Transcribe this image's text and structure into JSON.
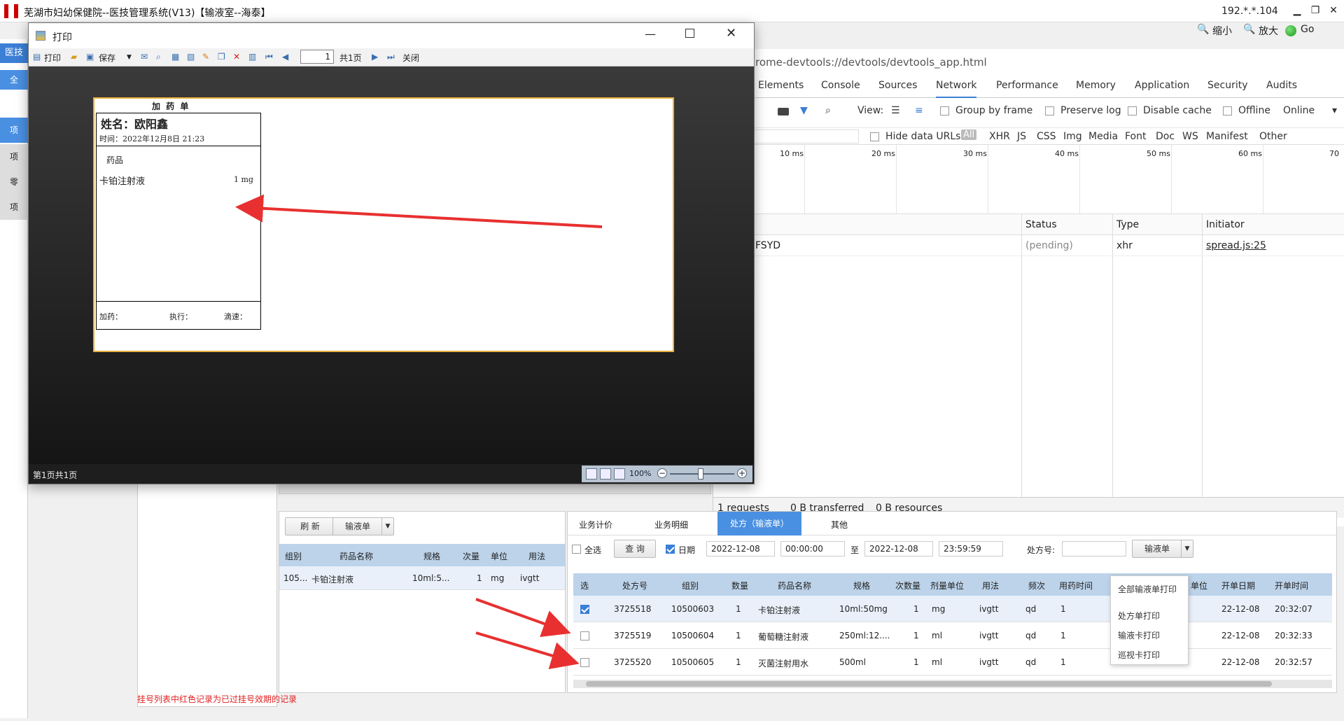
{
  "app": {
    "title": "芜湖市妇幼保健院--医技管理系统(V13)【输液室--海泰】",
    "ip": "192.*.*.104",
    "zoom_out": "缩小",
    "zoom_in": "放大",
    "go": "Go"
  },
  "sidebar": {
    "items": [
      "医技",
      "全",
      "项",
      "项",
      "零",
      "项"
    ]
  },
  "devtools": {
    "url": "rome-devtools://devtools/devtools_app.html",
    "tabs": [
      "Elements",
      "Console",
      "Sources",
      "Network",
      "Performance",
      "Memory",
      "Application",
      "Security",
      "Audits"
    ],
    "active_tab": "Network",
    "toolbar": {
      "view": "View:",
      "group_by_frame": "Group by frame",
      "preserve_log": "Preserve log",
      "disable_cache": "Disable cache",
      "offline": "Offline",
      "online": "Online"
    },
    "filters": {
      "hide_data_urls": "Hide data URLs",
      "types": [
        "All",
        "XHR",
        "JS",
        "CSS",
        "Img",
        "Media",
        "Font",
        "Doc",
        "WS",
        "Manifest",
        "Other"
      ]
    },
    "timeline": [
      "10 ms",
      "20 ms",
      "30 ms",
      "40 ms",
      "50 ms",
      "60 ms",
      "70"
    ],
    "columns": [
      "Status",
      "Type",
      "Initiator"
    ],
    "request": {
      "name": "FSYD",
      "status": "(pending)",
      "type": "xhr",
      "initiator": "spread.js:25"
    },
    "summary": {
      "requests": "1 requests",
      "transferred": "0 B transferred",
      "resources": "0 B resources"
    }
  },
  "print": {
    "title": "打印",
    "toolbar": {
      "print": "打印",
      "save": "保存",
      "page": "1",
      "total": "共1页",
      "close": "关闭"
    },
    "status": "第1页共1页",
    "zoom": "100%",
    "slip": {
      "title": "加 药 单",
      "name": "姓名：欧阳鑫",
      "time": "时间：2022年12月8日 21:23",
      "drug_header": "药品",
      "drug": "卡铂注射液",
      "dose": "1 mg",
      "add": "加药：",
      "exec": "执行：",
      "drip": "滴速："
    }
  },
  "left": {
    "refresh": "刷 新",
    "infusion": "输液单",
    "headers": [
      "组别",
      "药品名称",
      "规格",
      "次量",
      "单位",
      "用法"
    ],
    "row": [
      "105...",
      "卡铂注射液",
      "10ml:5...",
      "1",
      "mg",
      "ivgtt"
    ],
    "note": "挂号列表中红色记录为已过挂号效期的记录"
  },
  "right": {
    "tabs": [
      "业务计价",
      "业务明细",
      "处方（输液单）",
      "其他"
    ],
    "active_tab": "处方（输液单）",
    "filter": {
      "select_all": "全选",
      "query": "查 询",
      "date": "日期",
      "date_from": "2022-12-08",
      "time_from": "00:00:00",
      "to": "至",
      "date_to": "2022-12-08",
      "time_to": "23:59:59",
      "rx_no": "处方号:",
      "infusion_btn": "输液单"
    },
    "headers": [
      "选",
      "处方号",
      "组别",
      "数量",
      "药品名称",
      "规格",
      "次数量",
      "剂量单位",
      "用法",
      "频次",
      "用药时间",
      "单位",
      "开单日期",
      "开单时间"
    ],
    "rows": [
      {
        "checked": true,
        "rx": "3725518",
        "group": "10500603",
        "qty": "1",
        "drug": "卡铂注射液",
        "spec": "10ml:50mg",
        "times": "1",
        "unit": "mg",
        "usage": "ivgtt",
        "freq": "qd",
        "t": "1",
        "date": "22-12-08",
        "time": "20:32:07"
      },
      {
        "checked": false,
        "rx": "3725519",
        "group": "10500604",
        "qty": "1",
        "drug": "葡萄糖注射液",
        "spec": "250ml:12....",
        "times": "1",
        "unit": "ml",
        "usage": "ivgtt",
        "freq": "qd",
        "t": "1",
        "date": "22-12-08",
        "time": "20:32:33"
      },
      {
        "checked": false,
        "rx": "3725520",
        "group": "10500605",
        "qty": "1",
        "drug": "灭菌注射用水",
        "spec": "500ml",
        "times": "1",
        "unit": "ml",
        "usage": "ivgtt",
        "freq": "qd",
        "t": "1",
        "date": "22-12-08",
        "time": "20:32:57"
      }
    ],
    "menu": [
      "全部输液单打印",
      "处方单打印",
      "输液卡打印",
      "巡视卡打印"
    ]
  },
  "colors": {
    "accent": "#4a90e2",
    "annotation": "#e83030",
    "paper_border": "#e8b03a"
  }
}
